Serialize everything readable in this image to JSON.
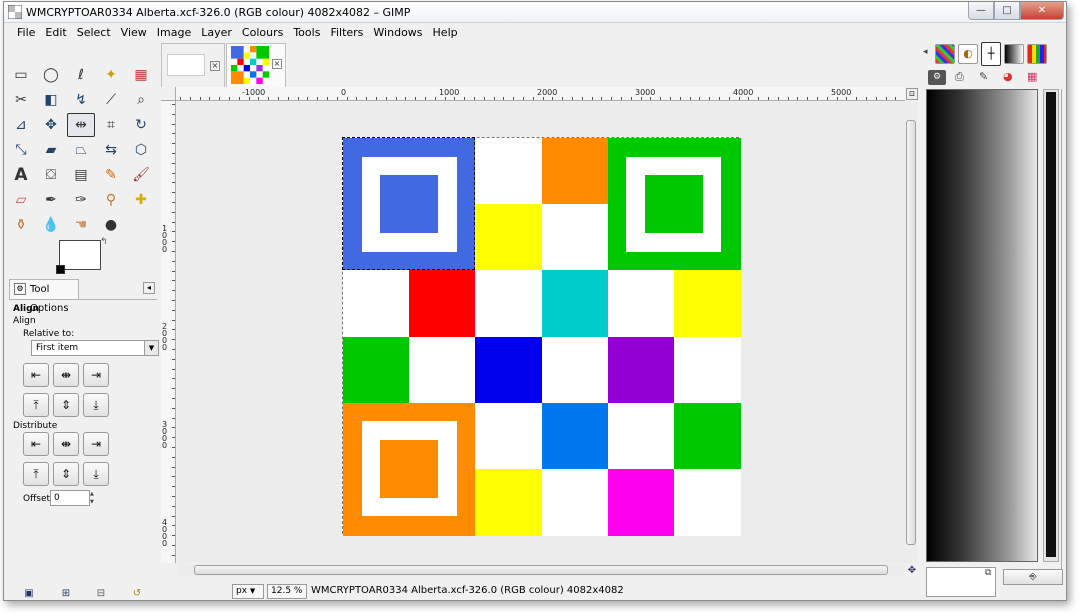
{
  "window": {
    "title": "WMCRYPTOAR0334 Alberta.xcf-326.0 (RGB colour) 4082x4082 – GIMP",
    "controls": {
      "minimize": "—",
      "maximize": "□",
      "close": "✕"
    }
  },
  "menubar": [
    "File",
    "Edit",
    "Select",
    "View",
    "Image",
    "Layer",
    "Colours",
    "Tools",
    "Filters",
    "Windows",
    "Help"
  ],
  "toolbox": {
    "tools": [
      "rect-select-icon",
      "ellipse-select-icon",
      "free-select-icon",
      "fuzzy-select-icon",
      "color-select-icon",
      "scissors-icon",
      "foreground-select-icon",
      "paths-icon",
      "color-picker-icon",
      "zoom-icon",
      "measure-icon",
      "move-icon",
      "align-icon",
      "crop-icon",
      "rotate-icon",
      "scale-icon",
      "shear-icon",
      "perspective-icon",
      "flip-icon",
      "cage-icon",
      "text-icon",
      "bucket-fill-icon",
      "blend-icon",
      "pencil-icon",
      "paintbrush-icon",
      "eraser-icon",
      "airbrush-icon",
      "ink-icon",
      "clone-icon",
      "heal-icon",
      "perspective-clone-icon",
      "blur-icon",
      "smudge-icon",
      "dodge-burn-icon"
    ],
    "active_tool": "align-icon"
  },
  "tool_options": {
    "tab_label": "Tool Options",
    "title": "Align",
    "subtitle": "Align",
    "relative_to_label": "Relative to:",
    "relative_to_value": "First item",
    "distribute_label": "Distribute",
    "offset_label": "Offset:",
    "offset_value": "0"
  },
  "image_tabs": [
    {
      "name": "blank-image-tab"
    },
    {
      "name": "alberta-image-tab"
    }
  ],
  "rulers": {
    "horizontal_labels": [
      "-1000",
      "0",
      "1000",
      "2000",
      "3000",
      "4000",
      "5000"
    ],
    "vertical_labels": [
      "1000",
      "2000",
      "3000",
      "4000"
    ]
  },
  "image": {
    "grid": [
      [
        "#4169e1",
        "#4169e1",
        "#ffffff",
        "#ff8c00",
        "#00c800",
        "#00c800"
      ],
      [
        "#4169e1",
        "#4169e1",
        "#ffff00",
        "#ffffff",
        "#00c800",
        "#00c800"
      ],
      [
        "#ffffff",
        "#ff0000",
        "#ffffff",
        "#00cccc",
        "#ffffff",
        "#ffff00"
      ],
      [
        "#00c800",
        "#ffffff",
        "#0000ee",
        "#ffffff",
        "#9400d3",
        "#ffffff"
      ],
      [
        "#ff8c00",
        "#ff8c00",
        "#ffffff",
        "#0077ee",
        "#ffffff",
        "#00c800"
      ],
      [
        "#ff8c00",
        "#ff8c00",
        "#ffff00",
        "#ffffff",
        "#ff00ee",
        "#ffffff"
      ]
    ],
    "finder_blocks": [
      {
        "corner": "top-left",
        "color": "#4169e1"
      },
      {
        "corner": "top-right",
        "color": "#00c800"
      },
      {
        "corner": "bottom-left",
        "color": "#ff8c00"
      }
    ]
  },
  "statusbar": {
    "unit": "px",
    "zoom": "12.5 %",
    "text": "WMCRYPTOAR0334 Alberta.xcf-326.0 (RGB colour) 4082x4082"
  },
  "dock": {
    "tab_icons": [
      "pattern-icon",
      "brush-icon",
      "cursor-icon",
      "gradient-icon",
      "palette-icon"
    ],
    "sub_icons": [
      "tool-options-icon",
      "device-icon",
      "paintbrush-icon",
      "color-wheel-icon",
      "palette-small-icon"
    ]
  },
  "toolbox_bottom": [
    "save-options-icon",
    "restore-options-icon",
    "delete-options-icon",
    "reset-options-icon"
  ]
}
